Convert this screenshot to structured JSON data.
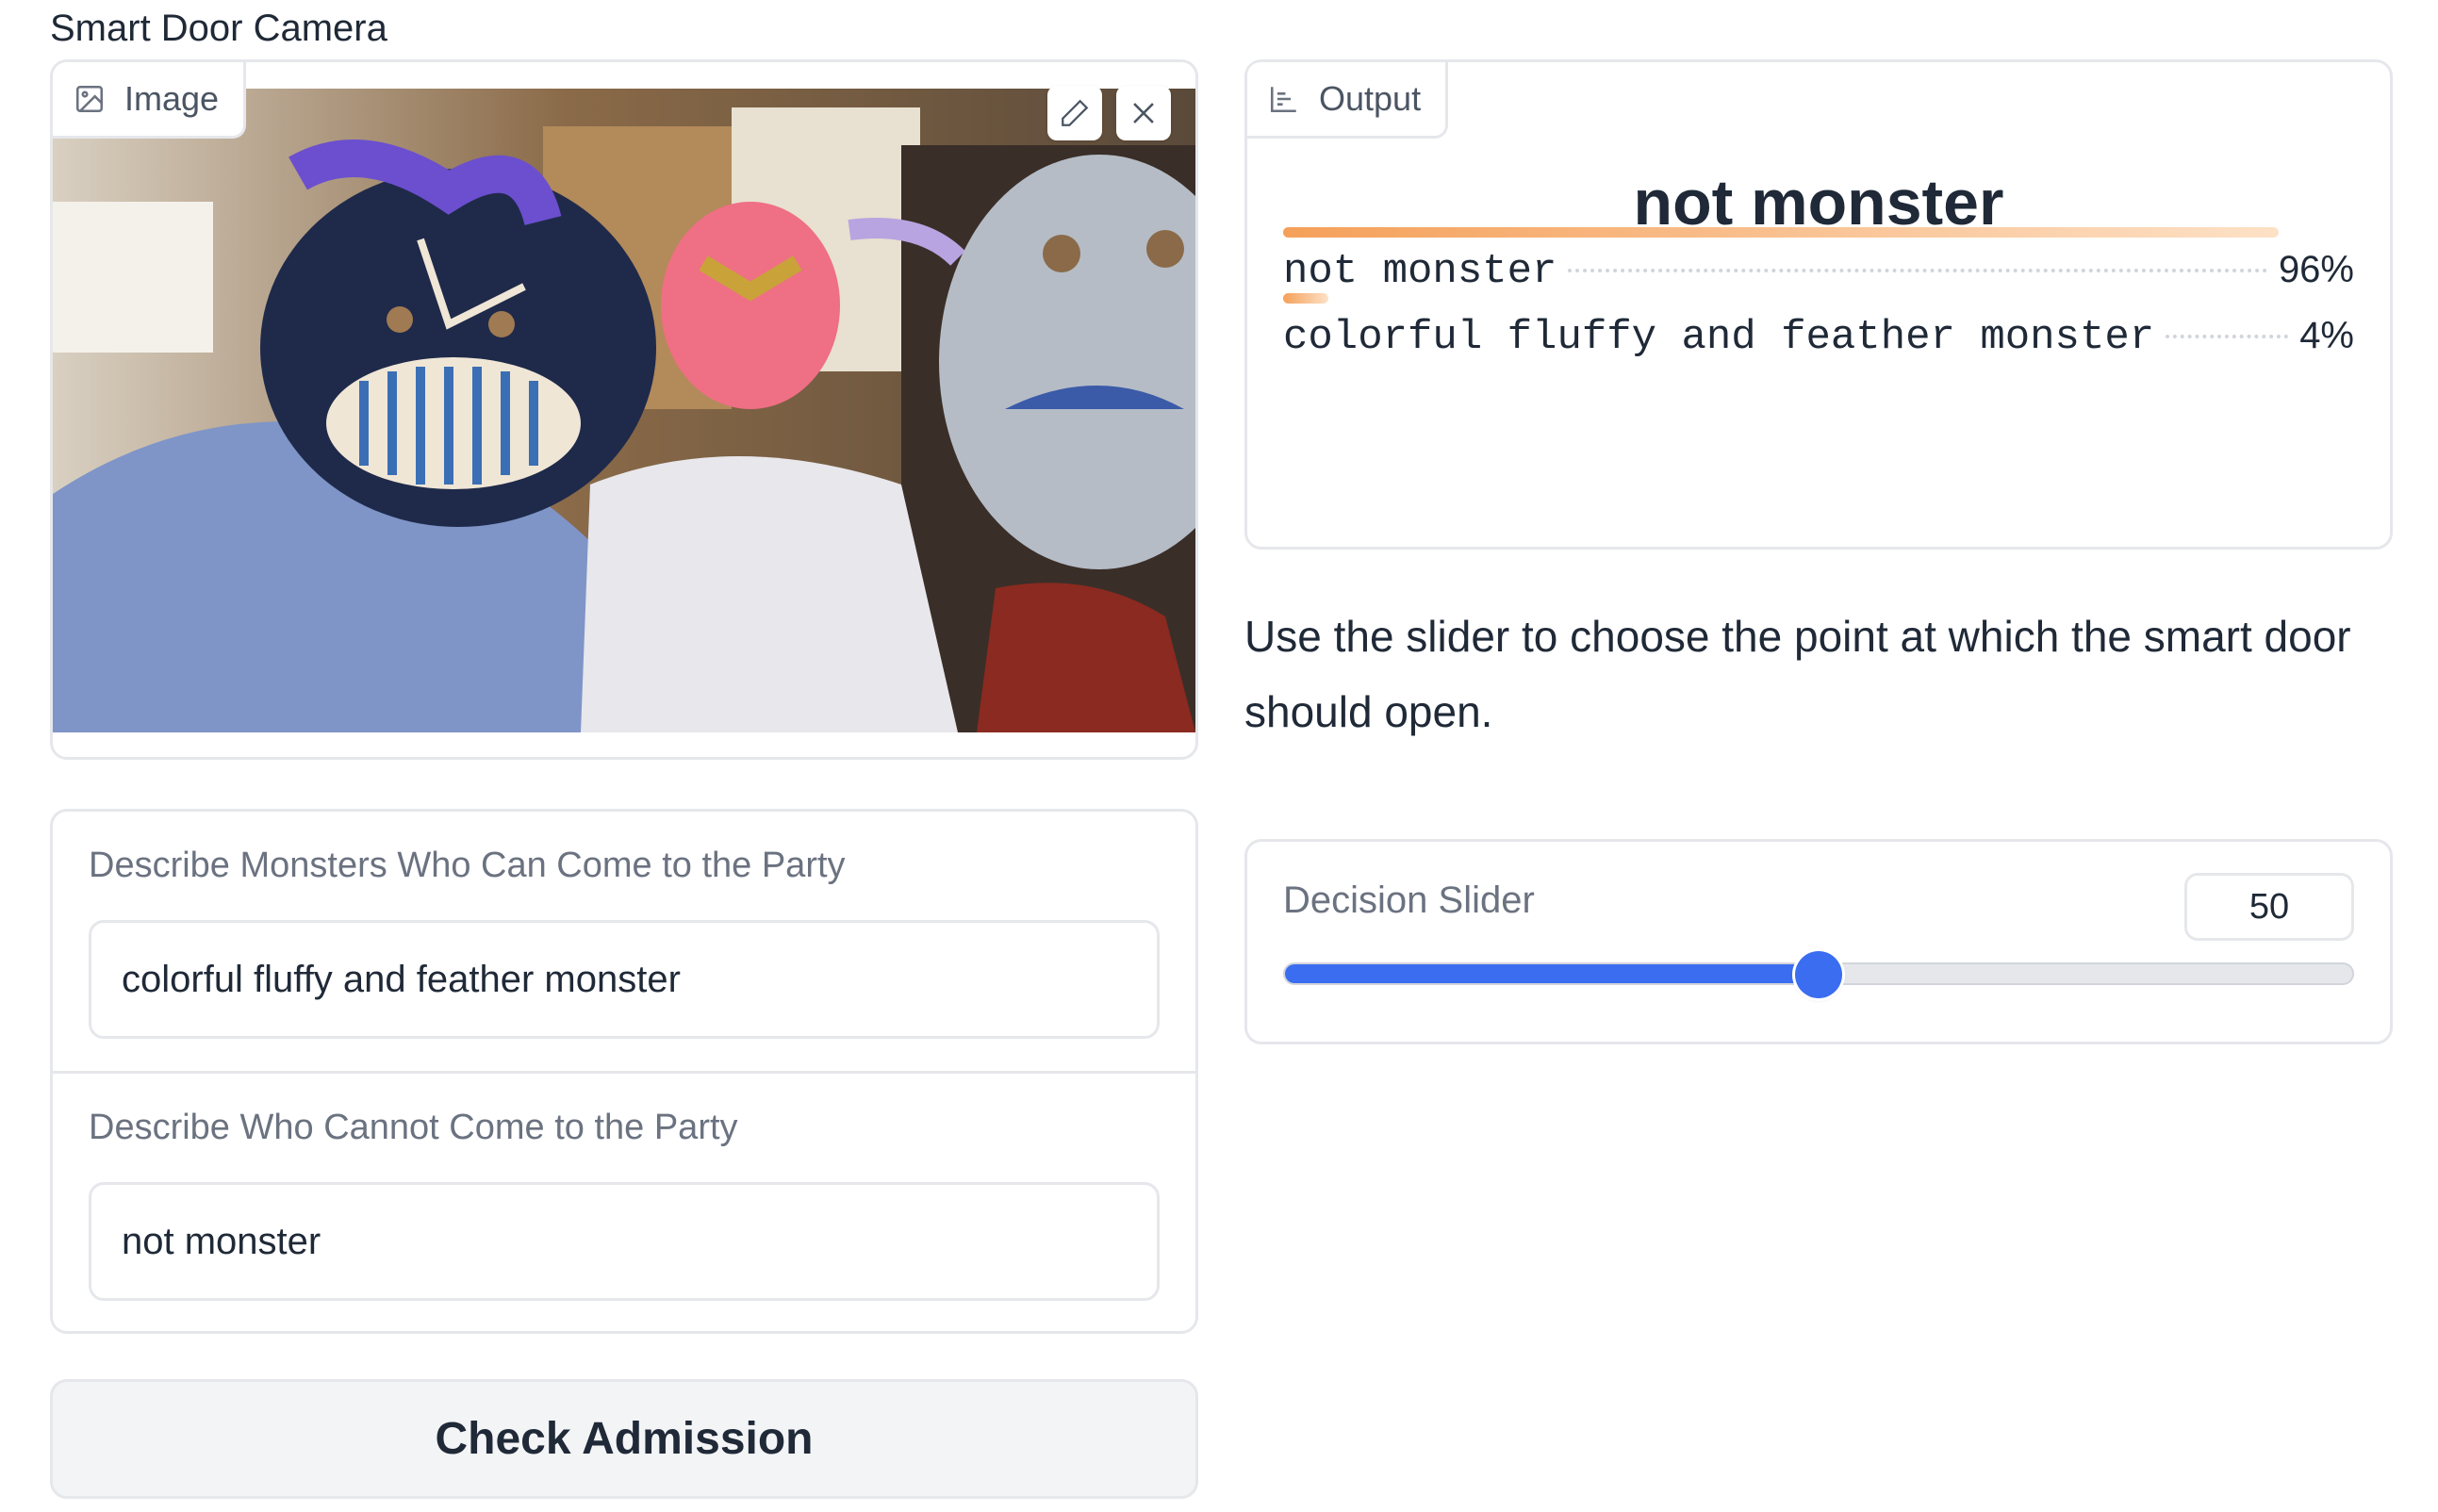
{
  "page": {
    "title": "Smart Door Camera"
  },
  "image_panel": {
    "label": "Image",
    "edit_icon": "pencil-icon",
    "clear_icon": "close-icon"
  },
  "monsters_field": {
    "label": "Describe Monsters Who Can Come to the Party",
    "value": "colorful fluffy and feather monster"
  },
  "non_monsters_field": {
    "label": "Describe Who Cannot Come to the Party",
    "value": "not monster"
  },
  "submit": {
    "label": "Check Admission"
  },
  "output": {
    "label": "Output",
    "top_label": "not monster",
    "confidences": [
      {
        "label": "not monster",
        "value": 0.96,
        "percent": "96%"
      },
      {
        "label": "colorful fluffy and feather monster",
        "value": 0.04,
        "percent": "4%"
      }
    ]
  },
  "instructions": "Use the slider to choose the point at which the smart door should open.",
  "slider": {
    "label": "Decision Slider",
    "value": "50",
    "min": 0,
    "max": 100,
    "fraction": 0.5
  },
  "colors": {
    "accent": "#3b6df1",
    "confidence_bar": "#f5a05a",
    "border": "#e5e7eb"
  }
}
